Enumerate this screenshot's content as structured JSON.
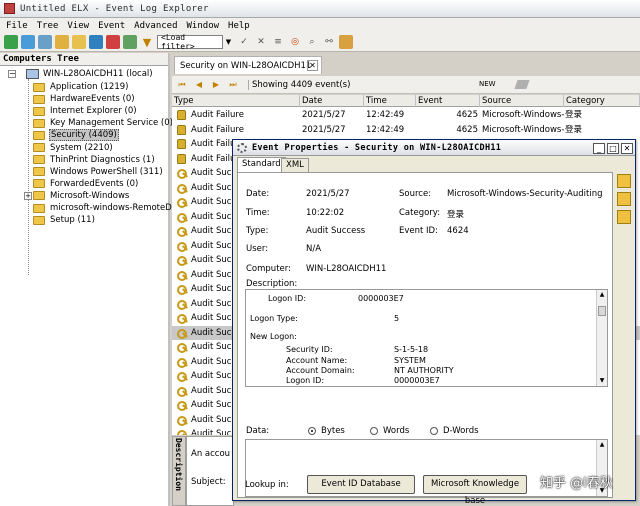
{
  "window": {
    "title": "Untitled ELX - Event Log Explorer"
  },
  "menu": [
    "File",
    "Tree",
    "View",
    "Event",
    "Advanced",
    "Window",
    "Help"
  ],
  "toolbar": {
    "filter_value": "<Load filter>"
  },
  "left_pane": {
    "title": "Computers Tree",
    "root": "WIN-L28OAICDH11 (local)",
    "items": [
      {
        "label": "Application (1219)"
      },
      {
        "label": "HardwareEvents (0)"
      },
      {
        "label": "Internet Explorer (0)"
      },
      {
        "label": "Key Management Service (0)"
      },
      {
        "label": "Security (4409)",
        "selected": true
      },
      {
        "label": "System (2210)"
      },
      {
        "label": "ThinPrint Diagnostics (1)"
      },
      {
        "label": "Windows PowerShell (311)"
      },
      {
        "label": "ForwardedEvents (0)"
      },
      {
        "label": "Microsoft-Windows",
        "expandable": true
      },
      {
        "label": "microsoft-windows-RemoteDesk"
      },
      {
        "label": "Setup (11)"
      }
    ]
  },
  "tab": {
    "label": "Security on WIN-L28OAICDH11"
  },
  "subbar": {
    "showing": "Showing 4409 event(s)",
    "new_label": "NEW"
  },
  "grid": {
    "columns": [
      "Type",
      "Date",
      "Time",
      "Event",
      "Source",
      "Category"
    ],
    "rows": [
      {
        "type": "Audit Failure",
        "date": "2021/5/27",
        "time": "12:42:49",
        "event": "4625",
        "source": "Microsoft-Windows-Se",
        "category": "登录",
        "icon": "lock"
      },
      {
        "type": "Audit Failure",
        "date": "2021/5/27",
        "time": "12:42:49",
        "event": "4625",
        "source": "Microsoft-Windows-Se",
        "category": "登录",
        "icon": "lock"
      },
      {
        "type": "Audit Failure",
        "icon": "lock"
      },
      {
        "type": "Audit Failure",
        "icon": "lock"
      },
      {
        "type": "Audit Success",
        "icon": "key"
      },
      {
        "type": "Audit Success",
        "icon": "key"
      },
      {
        "type": "Audit Success",
        "icon": "key"
      },
      {
        "type": "Audit Success",
        "icon": "key"
      },
      {
        "type": "Audit Success",
        "icon": "key"
      },
      {
        "type": "Audit Success",
        "icon": "key"
      },
      {
        "type": "Audit Success",
        "icon": "key"
      },
      {
        "type": "Audit Success",
        "icon": "key"
      },
      {
        "type": "Audit Success",
        "icon": "key"
      },
      {
        "type": "Audit Success",
        "icon": "key"
      },
      {
        "type": "Audit Success",
        "icon": "key"
      },
      {
        "type": "Audit Success",
        "icon": "key",
        "selected": true
      },
      {
        "type": "Audit Success",
        "icon": "key"
      },
      {
        "type": "Audit Success",
        "icon": "key"
      },
      {
        "type": "Audit Success",
        "icon": "key"
      },
      {
        "type": "Audit Success",
        "icon": "key"
      },
      {
        "type": "Audit Success",
        "icon": "key"
      },
      {
        "type": "Audit Success",
        "icon": "key"
      },
      {
        "type": "Audit Success",
        "icon": "key"
      }
    ]
  },
  "description_pane": {
    "header": "Description",
    "first_line": "An accou",
    "subject": "Subject:"
  },
  "dialog": {
    "title": "Event Properties - Security on WIN-L28OAICDH11",
    "tabs": [
      "Standard",
      "XML"
    ],
    "labels": {
      "date": "Date:",
      "time": "Time:",
      "type": "Type:",
      "user": "User:",
      "computer": "Computer:",
      "description": "Description:",
      "source": "Source:",
      "category": "Category:",
      "event_id": "Event ID:",
      "data": "Data:",
      "lookup": "Lookup in:"
    },
    "values": {
      "date": "2021/5/27",
      "time": "10:22:02",
      "type": "Audit Success",
      "user": "N/A",
      "computer": "WIN-L28OAICDH11",
      "source": "Microsoft-Windows-Security-Auditing",
      "category": "登录",
      "event_id": "4624"
    },
    "description_lines": [
      {
        "text": "Logon ID:",
        "value": "0000003E7",
        "indent": 1
      },
      {
        "text": "Logon Type:",
        "value": "5",
        "indent": 0
      },
      {
        "text": "New Logon:",
        "value": "",
        "indent": 0
      },
      {
        "text": "Security ID:",
        "value": "S-1-5-18",
        "indent": 2
      },
      {
        "text": "Account Name:",
        "value": "SYSTEM",
        "indent": 2
      },
      {
        "text": "Account Domain:",
        "value": "NT AUTHORITY",
        "indent": 2
      },
      {
        "text": "Logon ID:",
        "value": "0000003E7",
        "indent": 2
      }
    ],
    "data_format": {
      "options": [
        "Bytes",
        "Words",
        "D-Words"
      ],
      "selected": "Bytes"
    },
    "buttons": {
      "event_db": "Event ID Database",
      "kb": "Microsoft Knowledge base"
    }
  },
  "watermark": "知乎 @l春秋"
}
